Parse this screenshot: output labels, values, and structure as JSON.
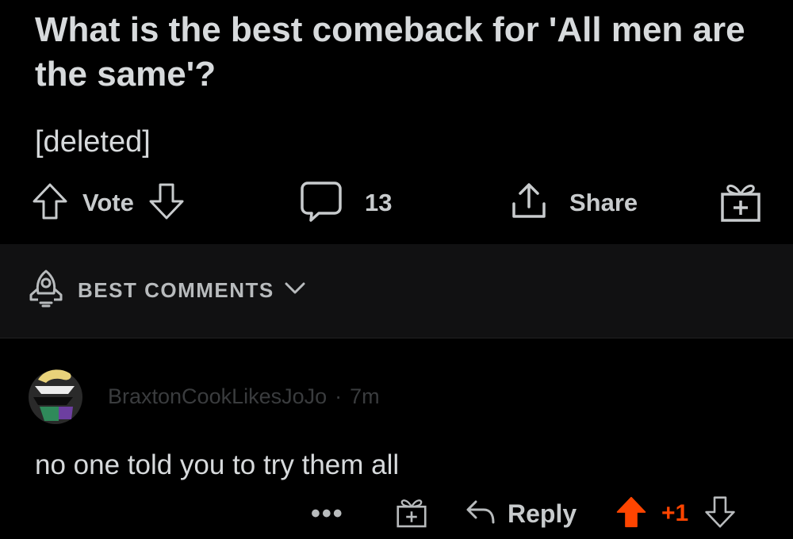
{
  "post": {
    "title": "What is the best comeback for 'All men are the same'?",
    "body": "[deleted]",
    "actions": {
      "vote_label": "Vote",
      "comments_count": "13",
      "share_label": "Share"
    }
  },
  "sort": {
    "label": "BEST COMMENTS"
  },
  "comment": {
    "username": "BraxtonCookLikesJoJo",
    "separator": "·",
    "age": "7m",
    "text": "no one told you to try them all",
    "more_label": "•••",
    "reply_label": "Reply",
    "score": "+1"
  },
  "colors": {
    "background": "#000000",
    "text": "#d7dadc",
    "upvote_accent": "#ff4500",
    "sort_bar_bg": "#111112"
  },
  "icons": [
    "arrow-up-icon",
    "arrow-down-icon",
    "comment-bubble-icon",
    "share-icon",
    "award-gift-icon",
    "rocket-icon",
    "chevron-down-icon",
    "reply-arrow-icon",
    "more-dots-icon"
  ]
}
